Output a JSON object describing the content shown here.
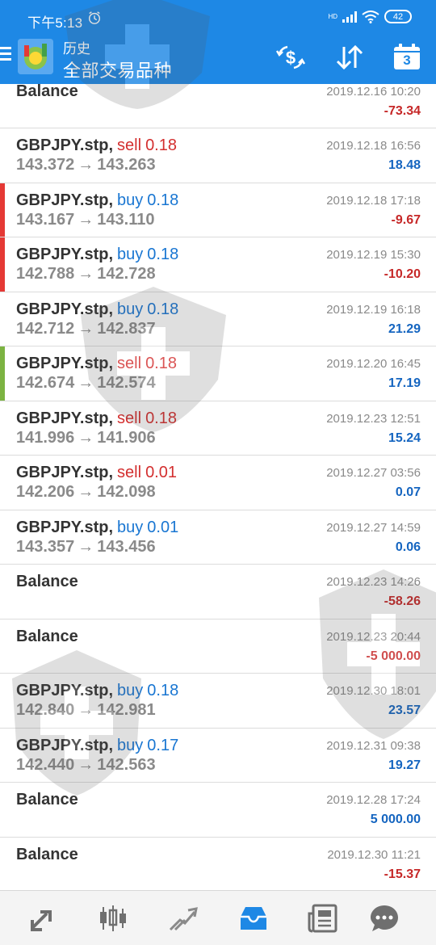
{
  "status_bar": {
    "time": "下午5:13",
    "network": "HD",
    "battery": "42"
  },
  "header": {
    "title": "历史",
    "subtitle": "全部交易品种",
    "calendar_day": "3",
    "background_color": "#1e88e5",
    "icons": [
      "menu-icon",
      "app-logo",
      "currency-exchange-icon",
      "sort-icon",
      "calendar-icon"
    ]
  },
  "colors": {
    "sell": "#d32f2f",
    "buy": "#1976d2",
    "loss": "#c62828",
    "profit": "#1565c0",
    "marker_red": "#e53935",
    "marker_green": "#7cb342"
  },
  "arrow": "→",
  "rows": [
    {
      "symbol": "Balance",
      "direction": "",
      "lots": "",
      "from": "",
      "to": "",
      "time": "2019.12.16 10:20",
      "profit": "-73.34",
      "type": "balance",
      "sign": "neg",
      "marker": ""
    },
    {
      "symbol": "GBPJPY.stp,",
      "direction": "sell",
      "lots": "0.18",
      "from": "143.372",
      "to": "143.263",
      "time": "2019.12.18 16:56",
      "profit": "18.48",
      "type": "trade",
      "sign": "pos",
      "marker": ""
    },
    {
      "symbol": "GBPJPY.stp,",
      "direction": "buy",
      "lots": "0.18",
      "from": "143.167",
      "to": "143.110",
      "time": "2019.12.18 17:18",
      "profit": "-9.67",
      "type": "trade",
      "sign": "neg",
      "marker": "red"
    },
    {
      "symbol": "GBPJPY.stp,",
      "direction": "buy",
      "lots": "0.18",
      "from": "142.788",
      "to": "142.728",
      "time": "2019.12.19 15:30",
      "profit": "-10.20",
      "type": "trade",
      "sign": "neg",
      "marker": "red"
    },
    {
      "symbol": "GBPJPY.stp,",
      "direction": "buy",
      "lots": "0.18",
      "from": "142.712",
      "to": "142.837",
      "time": "2019.12.19 16:18",
      "profit": "21.29",
      "type": "trade",
      "sign": "pos",
      "marker": ""
    },
    {
      "symbol": "GBPJPY.stp,",
      "direction": "sell",
      "lots": "0.18",
      "from": "142.674",
      "to": "142.574",
      "time": "2019.12.20 16:45",
      "profit": "17.19",
      "type": "trade",
      "sign": "pos",
      "marker": "green"
    },
    {
      "symbol": "GBPJPY.stp,",
      "direction": "sell",
      "lots": "0.18",
      "from": "141.996",
      "to": "141.906",
      "time": "2019.12.23 12:51",
      "profit": "15.24",
      "type": "trade",
      "sign": "pos",
      "marker": ""
    },
    {
      "symbol": "GBPJPY.stp,",
      "direction": "sell",
      "lots": "0.01",
      "from": "142.206",
      "to": "142.098",
      "time": "2019.12.27 03:56",
      "profit": "0.07",
      "type": "trade",
      "sign": "pos",
      "marker": ""
    },
    {
      "symbol": "GBPJPY.stp,",
      "direction": "buy",
      "lots": "0.01",
      "from": "143.357",
      "to": "143.456",
      "time": "2019.12.27 14:59",
      "profit": "0.06",
      "type": "trade",
      "sign": "pos",
      "marker": ""
    },
    {
      "symbol": "Balance",
      "direction": "",
      "lots": "",
      "from": "",
      "to": "",
      "time": "2019.12.23 14:26",
      "profit": "-58.26",
      "type": "balance",
      "sign": "neg",
      "marker": ""
    },
    {
      "symbol": "Balance",
      "direction": "",
      "lots": "",
      "from": "",
      "to": "",
      "time": "2019.12.23 20:44",
      "profit": "-5 000.00",
      "type": "balance",
      "sign": "neg",
      "marker": ""
    },
    {
      "symbol": "GBPJPY.stp,",
      "direction": "buy",
      "lots": "0.18",
      "from": "142.840",
      "to": "142.981",
      "time": "2019.12.30 18:01",
      "profit": "23.57",
      "type": "trade",
      "sign": "pos",
      "marker": ""
    },
    {
      "symbol": "GBPJPY.stp,",
      "direction": "buy",
      "lots": "0.17",
      "from": "142.440",
      "to": "142.563",
      "time": "2019.12.31 09:38",
      "profit": "19.27",
      "type": "trade",
      "sign": "pos",
      "marker": ""
    },
    {
      "symbol": "Balance",
      "direction": "",
      "lots": "",
      "from": "",
      "to": "",
      "time": "2019.12.28 17:24",
      "profit": "5 000.00",
      "type": "balance",
      "sign": "pos",
      "marker": ""
    },
    {
      "symbol": "Balance",
      "direction": "",
      "lots": "",
      "from": "",
      "to": "",
      "time": "2019.12.30 11:21",
      "profit": "-15.37",
      "type": "balance",
      "sign": "neg",
      "marker": ""
    }
  ],
  "bottom_nav": [
    {
      "name": "quotes-icon",
      "active": false
    },
    {
      "name": "chart-icon",
      "active": false
    },
    {
      "name": "trade-icon",
      "active": false
    },
    {
      "name": "history-icon",
      "active": true
    },
    {
      "name": "news-icon",
      "active": false
    },
    {
      "name": "chat-icon",
      "active": false
    }
  ]
}
